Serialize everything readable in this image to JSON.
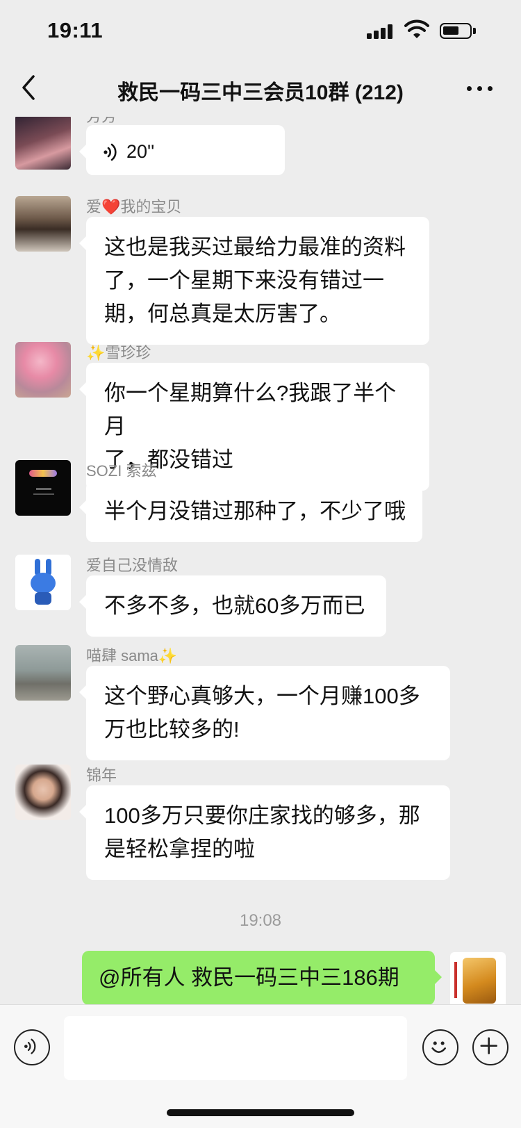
{
  "status_bar": {
    "time": "19:11"
  },
  "nav": {
    "title": "救民一码三中三会员10群 (212)"
  },
  "messages": [
    {
      "sender": "芳芳",
      "voice_duration": "20''"
    },
    {
      "sender": "爱❤️我的宝贝",
      "lines": [
        "这也是我买过最给力最准的资料",
        "了，一个星期下来没有错过一",
        "期，何总真是太厉害了。"
      ]
    },
    {
      "sender": "✨雪珍珍",
      "lines": [
        "你一个星期算什么?我跟了半个月",
        "了，都没错过"
      ]
    },
    {
      "sender": "SOZI 索兹",
      "lines": [
        "半个月没错过那种了，不少了哦"
      ]
    },
    {
      "sender": "爱自己没情敌",
      "lines": [
        "不多不多，也就60多万而已"
      ]
    },
    {
      "sender": "喵肆 sama✨",
      "lines": [
        "这个野心真够大，一个月赚100多",
        "万也比较多的!"
      ]
    },
    {
      "sender": "锦年",
      "lines": [
        "100多万只要你庄家找的够多，那",
        "是轻松拿捏的啦"
      ]
    }
  ],
  "timestamp": "19:08",
  "outgoing": {
    "text": "@所有人  救民一码三中三186期"
  },
  "input": {
    "placeholder": ""
  },
  "icons": {
    "back": "chevron-left-icon",
    "more": "more-dots-icon",
    "voice": "voice-icon",
    "emoji": "emoji-icon",
    "plus": "plus-icon"
  },
  "colors": {
    "background": "#ededed",
    "bubble_in": "#ffffff",
    "bubble_out": "#95ec69",
    "sender_text": "#8a8a8a"
  }
}
